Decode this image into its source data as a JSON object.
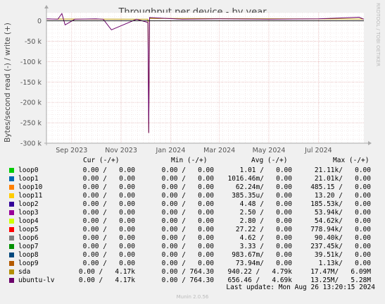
{
  "watermark": "RRDTOOL / TOBI OETIKER",
  "legend_headers": {
    "cur": "Cur (-/+)",
    "min": "Min (-/+)",
    "avg": "Avg (-/+)",
    "max": "Max (-/+)"
  },
  "legend": [
    {
      "name": "loop0",
      "color": "#00cc00",
      "cur": "0.00 /   0.00",
      "min": "0.00 /   0.00",
      "avg": "1.01 /   0.00",
      "max": "21.11k/   0.00"
    },
    {
      "name": "loop1",
      "color": "#0066b3",
      "cur": "0.00 /   0.00",
      "min": "0.00 /   0.00",
      "avg": "1016.46m/   0.00",
      "max": "21.01k/   0.00"
    },
    {
      "name": "loop10",
      "color": "#ff8000",
      "cur": "0.00 /   0.00",
      "min": "0.00 /   0.00",
      "avg": "62.24m/   0.00",
      "max": "485.15 /   0.00"
    },
    {
      "name": "loop11",
      "color": "#ffcc00",
      "cur": "0.00 /   0.00",
      "min": "0.00 /   0.00",
      "avg": "385.35u/   0.00",
      "max": "13.20 /   0.00"
    },
    {
      "name": "loop2",
      "color": "#330099",
      "cur": "0.00 /   0.00",
      "min": "0.00 /   0.00",
      "avg": "4.48 /   0.00",
      "max": "185.53k/   0.00"
    },
    {
      "name": "loop3",
      "color": "#990099",
      "cur": "0.00 /   0.00",
      "min": "0.00 /   0.00",
      "avg": "2.50 /   0.00",
      "max": "53.94k/   0.00"
    },
    {
      "name": "loop4",
      "color": "#ccff00",
      "cur": "0.00 /   0.00",
      "min": "0.00 /   0.00",
      "avg": "2.80 /   0.00",
      "max": "54.62k/   0.00"
    },
    {
      "name": "loop5",
      "color": "#ff0000",
      "cur": "0.00 /   0.00",
      "min": "0.00 /   0.00",
      "avg": "27.22 /   0.00",
      "max": "778.94k/   0.00"
    },
    {
      "name": "loop6",
      "color": "#808080",
      "cur": "0.00 /   0.00",
      "min": "0.00 /   0.00",
      "avg": "4.62 /   0.00",
      "max": "90.40k/   0.00"
    },
    {
      "name": "loop7",
      "color": "#008f00",
      "cur": "0.00 /   0.00",
      "min": "0.00 /   0.00",
      "avg": "3.33 /   0.00",
      "max": "237.45k/   0.00"
    },
    {
      "name": "loop8",
      "color": "#00487d",
      "cur": "0.00 /   0.00",
      "min": "0.00 /   0.00",
      "avg": "983.67m/   0.00",
      "max": "39.51k/   0.00"
    },
    {
      "name": "loop9",
      "color": "#b35a00",
      "cur": "0.00 /   0.00",
      "min": "0.00 /   0.00",
      "avg": "73.94m/   0.00",
      "max": "1.13k/   0.00"
    },
    {
      "name": "sda",
      "color": "#b38f00",
      "cur": "0.00 /   4.17k",
      "min": "0.00 / 764.30",
      "avg": "940.22 /   4.79k",
      "max": "17.47M/   6.09M"
    },
    {
      "name": "ubuntu-lv",
      "color": "#6b006b",
      "cur": "0.00 /   4.17k",
      "min": "0.00 / 764.30",
      "avg": "656.46 /   4.69k",
      "max": "13.25M/   5.28M"
    }
  ],
  "last_update": "Last update: Mon Aug 26 13:20:15 2024",
  "munin_version": "Munin 2.0.56",
  "chart_data": {
    "type": "line",
    "title": "Throughput per device - by year",
    "ylabel": "Bytes/second read (-) / write (+)",
    "xlabel": "",
    "ylim": [
      -300000,
      20000
    ],
    "yticks": [
      {
        "value": 0,
        "label": "0"
      },
      {
        "value": -50000,
        "label": "-50 k"
      },
      {
        "value": -100000,
        "label": "-100 k"
      },
      {
        "value": -150000,
        "label": "-150 k"
      },
      {
        "value": -200000,
        "label": "-200 k"
      },
      {
        "value": -250000,
        "label": "-250 k"
      },
      {
        "value": -300000,
        "label": "-300 k"
      }
    ],
    "xlim": [
      "2023-08-01",
      "2024-08-26"
    ],
    "xticks": [
      {
        "date": "2023-09-01",
        "label": "Sep 2023"
      },
      {
        "date": "2023-11-01",
        "label": "Nov 2023"
      },
      {
        "date": "2024-01-01",
        "label": "Jan 2024"
      },
      {
        "date": "2024-03-01",
        "label": "Mar 2024"
      },
      {
        "date": "2024-05-01",
        "label": "May 2024"
      },
      {
        "date": "2024-07-01",
        "label": "Jul 2024"
      }
    ],
    "grid": true,
    "series": [
      {
        "name": "ubuntu-lv",
        "color": "#6b006b",
        "x": [
          "2023-08-01",
          "2023-08-15",
          "2023-08-20",
          "2023-08-24",
          "2023-09-05",
          "2023-10-01",
          "2023-10-10",
          "2023-10-20",
          "2023-11-20",
          "2023-12-04",
          "2023-12-05",
          "2023-12-06",
          "2024-01-15",
          "2024-03-01",
          "2024-05-01",
          "2024-07-01",
          "2024-08-20",
          "2024-08-26"
        ],
        "y": [
          5000,
          4000,
          18000,
          -10000,
          4000,
          5000,
          4000,
          -22000,
          4000,
          -4000,
          -275000,
          8000,
          4000,
          5000,
          4000,
          5000,
          9000,
          4000
        ]
      },
      {
        "name": "sda",
        "color": "#b38f00",
        "x": [
          "2023-08-01",
          "2023-12-04",
          "2023-12-05",
          "2023-12-06",
          "2024-08-26"
        ],
        "y": [
          4500,
          4000,
          -275000,
          6000,
          4500
        ]
      }
    ]
  }
}
